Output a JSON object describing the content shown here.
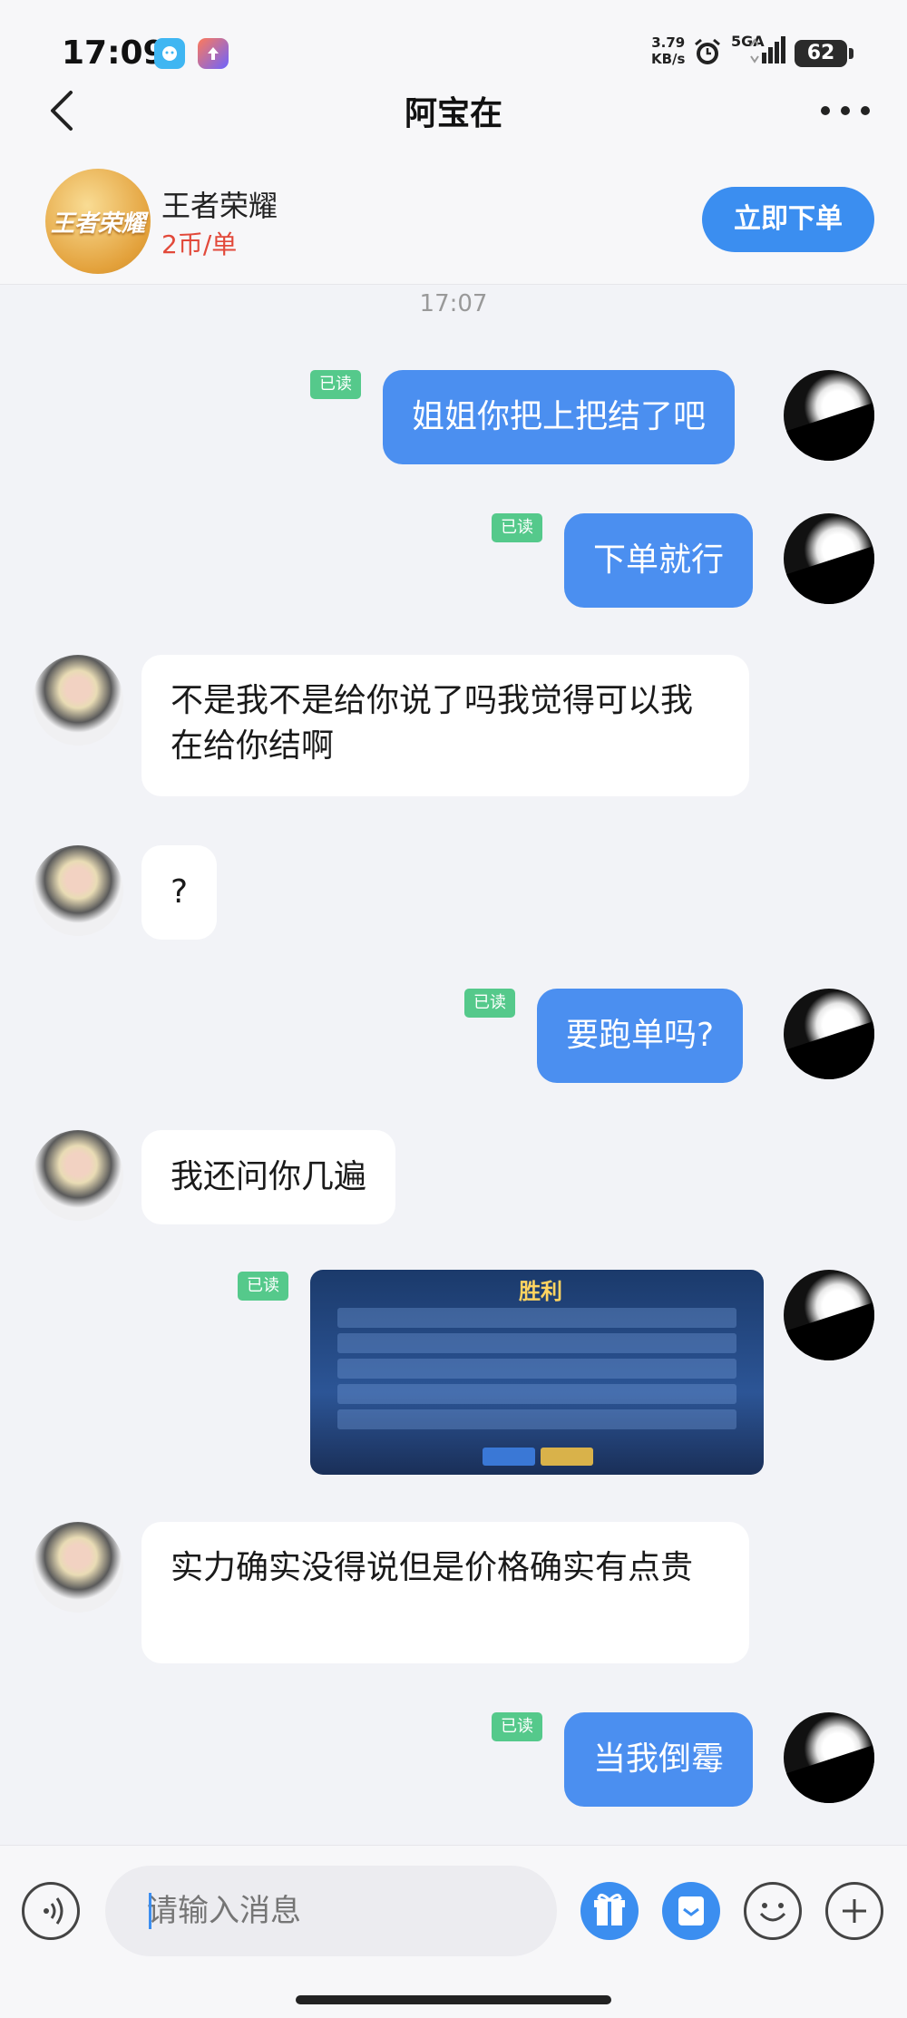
{
  "status_bar": {
    "time": "17:09",
    "net_speed_value": "3.79",
    "net_speed_unit": "KB/s",
    "signal": "5GA",
    "battery": "62"
  },
  "header": {
    "title": "阿宝在"
  },
  "product": {
    "logo_text": "王者荣耀",
    "name": "王者荣耀",
    "price": "2币/单",
    "order_button": "立即下单"
  },
  "chat": {
    "timestamp": "17:07",
    "read_label": "已读",
    "messages": [
      {
        "from": "me",
        "text": "姐姐你把上把结了吧"
      },
      {
        "from": "me",
        "text": "下单就行"
      },
      {
        "from": "her",
        "text": "不是我不是给你说了吗我觉得可以我在给你结啊"
      },
      {
        "from": "her",
        "text": "?"
      },
      {
        "from": "me",
        "text": "要跑单吗?"
      },
      {
        "from": "her",
        "text": "我还问你几遍"
      },
      {
        "from": "me",
        "type": "image",
        "text": "胜利"
      },
      {
        "from": "her",
        "text": "实力确实没得说但是价格确实有点贵"
      },
      {
        "from": "me",
        "text": "当我倒霉"
      }
    ]
  },
  "input": {
    "placeholder": "请输入消息"
  }
}
